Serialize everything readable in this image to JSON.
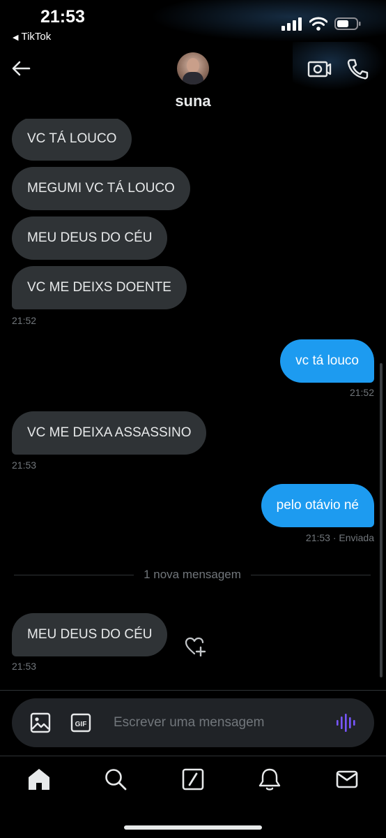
{
  "status_bar": {
    "time": "21:53",
    "back_app": "TikTok"
  },
  "header": {
    "username": "suna"
  },
  "messages": [
    {
      "text": "VC TÁ LOUCO"
    },
    {
      "text": "MEGUMI VC TÁ LOUCO"
    },
    {
      "text": "MEU DEUS DO CÉU"
    },
    {
      "text": "VC ME DEIXS DOENTE",
      "time": "21:52"
    },
    {
      "text": "vc tá louco",
      "time": "21:52"
    },
    {
      "text": "VC ME DEIXA ASSASSINO",
      "time": "21:53"
    },
    {
      "text": "pelo otávio né",
      "time": "21:53",
      "status": "· Enviada"
    },
    {
      "text": "MEU DEUS DO CÉU",
      "time": "21:53"
    }
  ],
  "divider": {
    "label": "1 nova mensagem"
  },
  "composer": {
    "placeholder": "Escrever uma mensagem",
    "gif_label": "GIF"
  },
  "colors": {
    "accent": "#1d9bf0",
    "incoming_bubble": "#2f3336",
    "voice": "#7856ff"
  },
  "icons": {
    "header": [
      "back-arrow-icon",
      "video-call-icon",
      "phone-icon"
    ],
    "composer": [
      "image-icon",
      "gif-icon",
      "voice-wave-icon"
    ],
    "tabs": [
      "home-icon",
      "search-icon",
      "compose-icon",
      "bell-icon",
      "mail-icon"
    ]
  }
}
